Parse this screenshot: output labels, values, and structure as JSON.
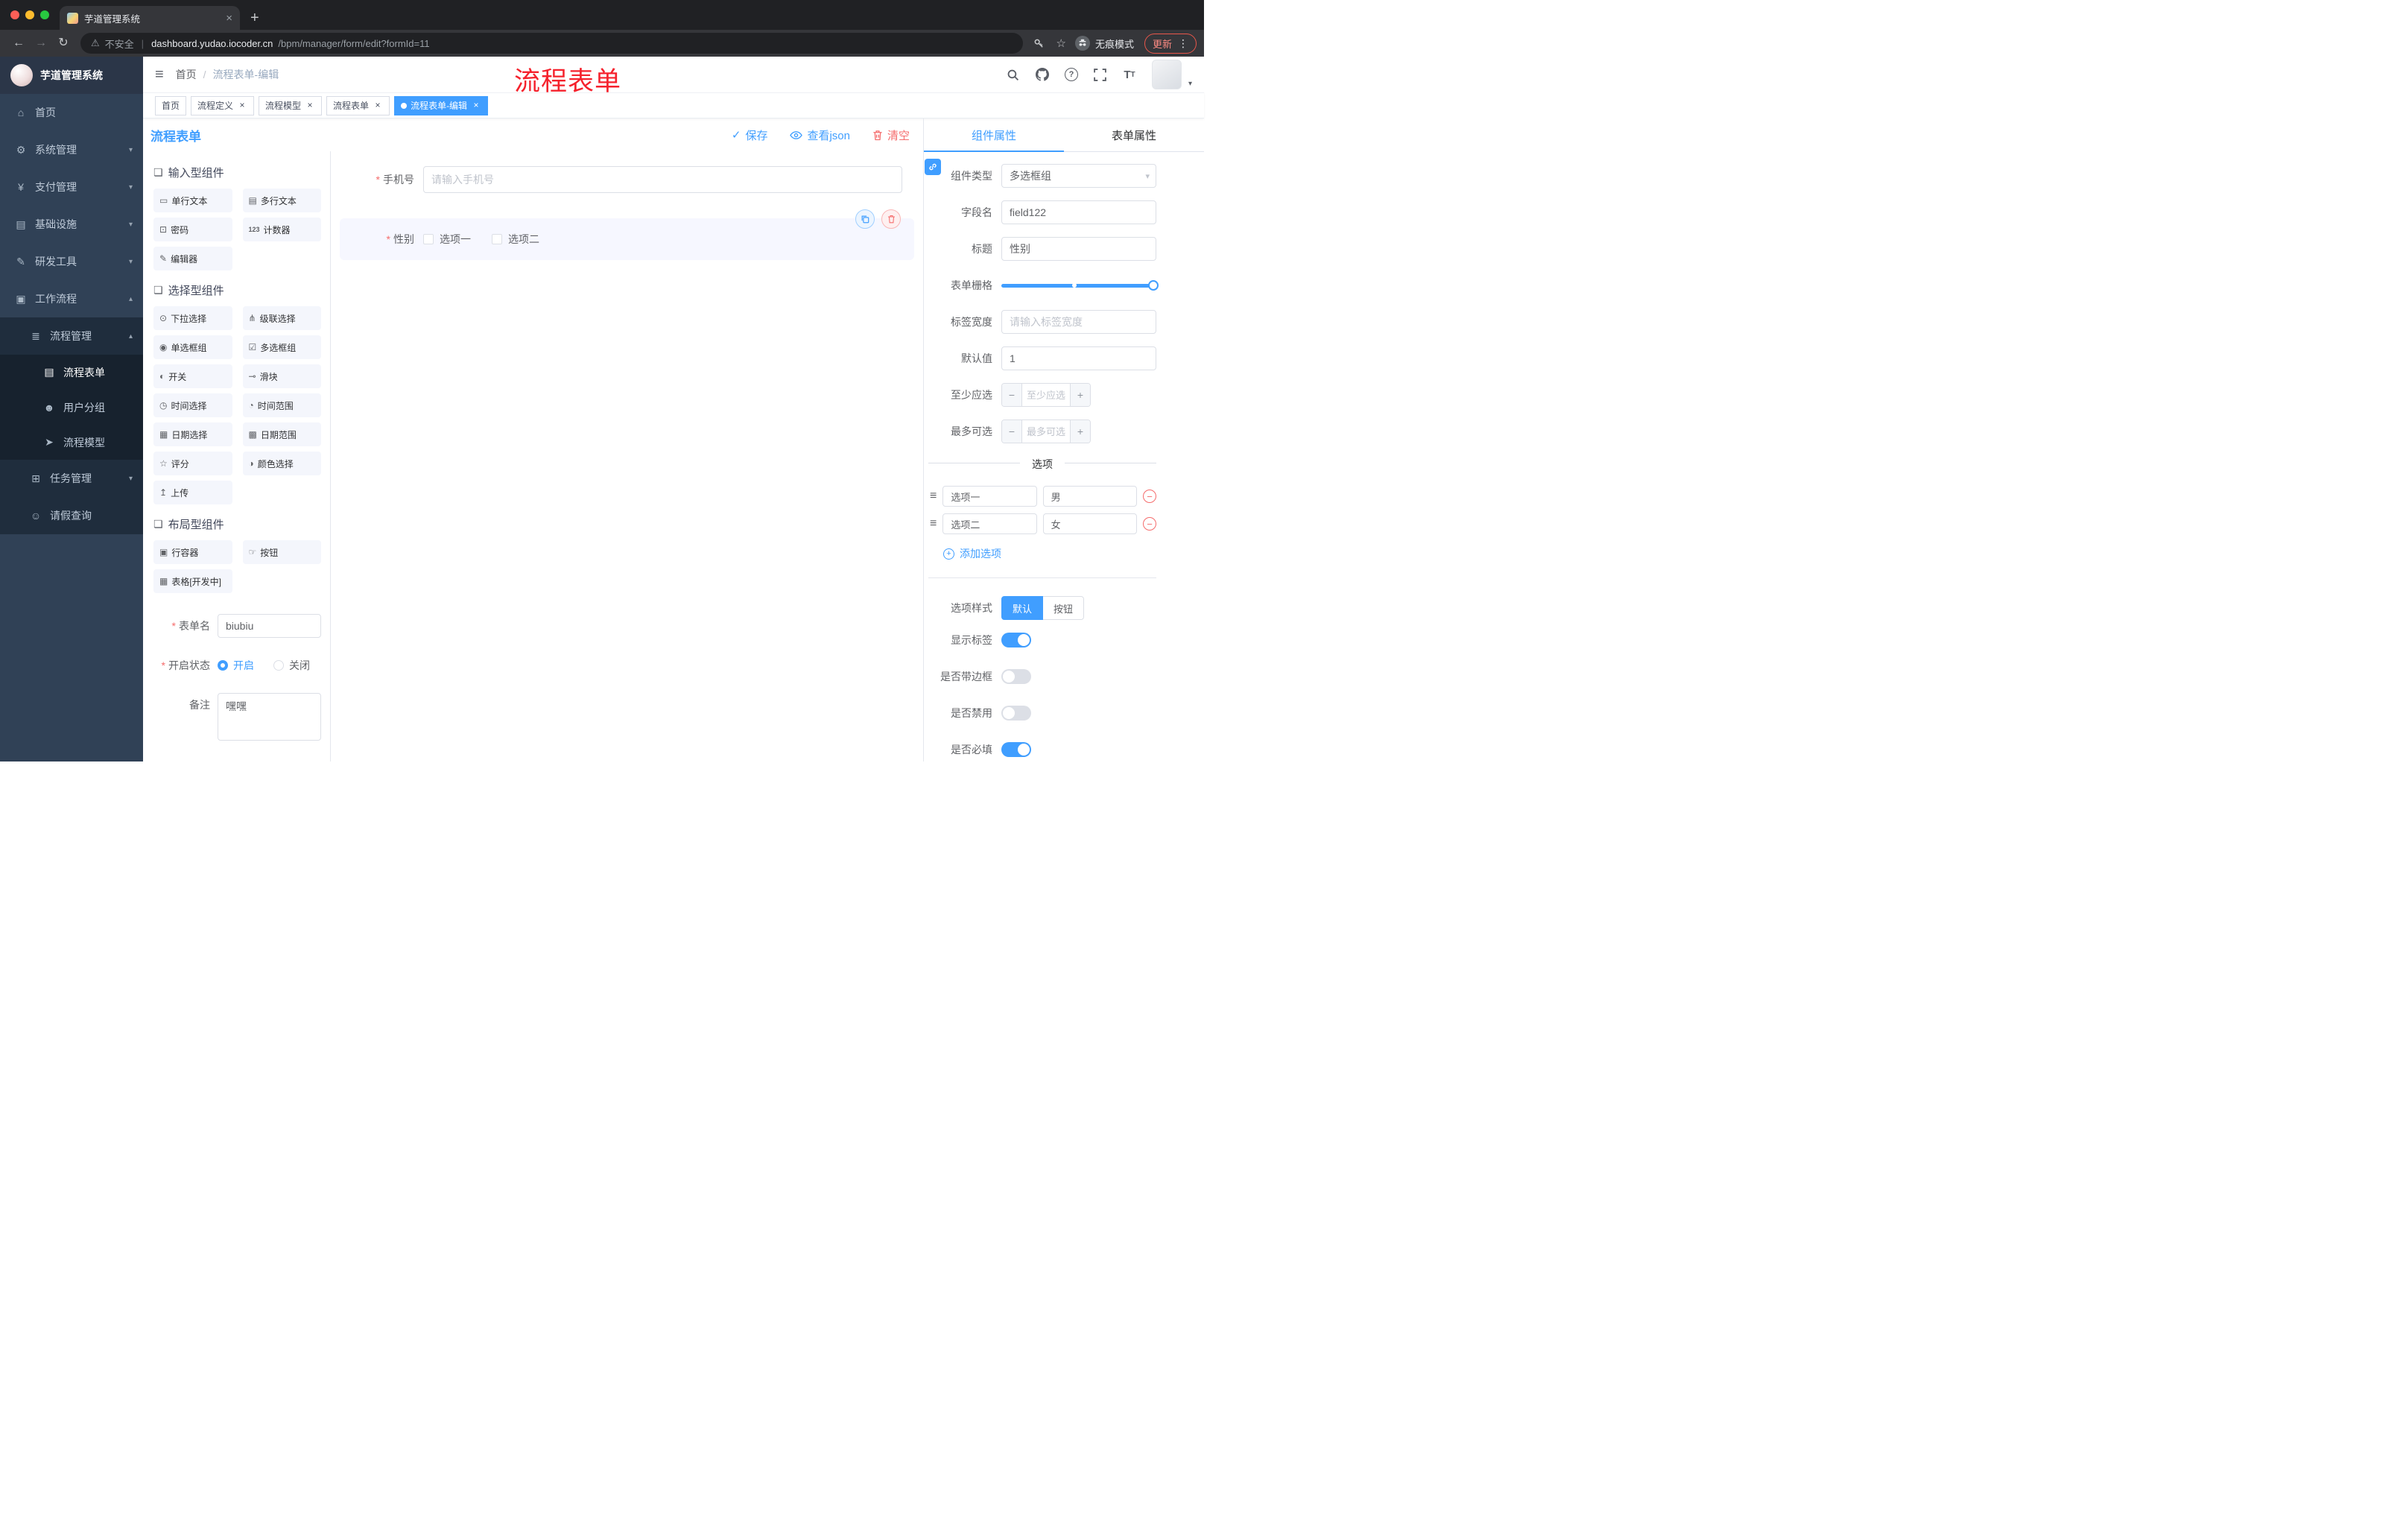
{
  "colors": {
    "primary": "#409eff",
    "danger": "#f56c6c",
    "annotation": "#f5222d",
    "sidebar": "#304156",
    "tag_active": "#409eff"
  },
  "chrome": {
    "tab_title": "芋道管理系统",
    "security": "不安全",
    "url_domain": "dashboard.yudao.iocoder.cn",
    "url_path": "/bpm/manager/form/edit?formId=11",
    "incognito": "无痕模式",
    "update": "更新"
  },
  "sidebar": {
    "logo": "芋道管理系统",
    "items": [
      {
        "label": "首页"
      },
      {
        "label": "系统管理"
      },
      {
        "label": "支付管理"
      },
      {
        "label": "基础设施"
      },
      {
        "label": "研发工具"
      },
      {
        "label": "工作流程"
      },
      {
        "label": "流程管理"
      },
      {
        "label": "流程表单"
      },
      {
        "label": "用户分组"
      },
      {
        "label": "流程模型"
      },
      {
        "label": "任务管理"
      },
      {
        "label": "请假查询"
      }
    ]
  },
  "header": {
    "breadcrumb": [
      "首页",
      "流程表单-编辑"
    ],
    "annotation": "流程表单"
  },
  "tags": [
    {
      "label": "首页",
      "closable": false,
      "active": false
    },
    {
      "label": "流程定义",
      "closable": true,
      "active": false
    },
    {
      "label": "流程模型",
      "closable": true,
      "active": false
    },
    {
      "label": "流程表单",
      "closable": true,
      "active": false
    },
    {
      "label": "流程表单-编辑",
      "closable": true,
      "active": true
    }
  ],
  "toolbar": {
    "title": "流程表单",
    "save": "保存",
    "view_json": "查看json",
    "clear": "清空"
  },
  "palette": {
    "sections": [
      {
        "title": "输入型组件",
        "items": [
          {
            "icon": "single-line-text-icon",
            "label": "单行文本"
          },
          {
            "icon": "multi-line-text-icon",
            "label": "多行文本"
          },
          {
            "icon": "password-icon",
            "label": "密码"
          },
          {
            "icon": "counter-icon",
            "label": "计数器"
          },
          {
            "icon": "editor-icon",
            "label": "编辑器"
          }
        ]
      },
      {
        "title": "选择型组件",
        "items": [
          {
            "icon": "dropdown-icon",
            "label": "下拉选择"
          },
          {
            "icon": "cascader-icon",
            "label": "级联选择"
          },
          {
            "icon": "radio-group-icon",
            "label": "单选框组"
          },
          {
            "icon": "checkbox-group-icon",
            "label": "多选框组"
          },
          {
            "icon": "switch-icon",
            "label": "开关"
          },
          {
            "icon": "slider-icon",
            "label": "滑块"
          },
          {
            "icon": "time-picker-icon",
            "label": "时间选择"
          },
          {
            "icon": "time-range-icon",
            "label": "时间范围"
          },
          {
            "icon": "date-picker-icon",
            "label": "日期选择"
          },
          {
            "icon": "date-range-icon",
            "label": "日期范围"
          },
          {
            "icon": "rate-icon",
            "label": "评分"
          },
          {
            "icon": "color-picker-icon",
            "label": "颜色选择"
          },
          {
            "icon": "upload-icon",
            "label": "上传"
          }
        ]
      },
      {
        "title": "布局型组件",
        "items": [
          {
            "icon": "row-container-icon",
            "label": "行容器"
          },
          {
            "icon": "button-icon",
            "label": "按钮"
          },
          {
            "icon": "table-icon",
            "label": "表格[开发中]"
          }
        ]
      }
    ]
  },
  "left_form": {
    "form_name_label": "表单名",
    "form_name_value": "biubiu",
    "status_label": "开启状态",
    "status_on": "开启",
    "status_off": "关闭",
    "remark_label": "备注",
    "remark_value": "嘿嘿"
  },
  "canvas": {
    "phone_label": "手机号",
    "phone_placeholder": "请输入手机号",
    "gender_label": "性别",
    "gender_options": [
      "选项一",
      "选项二"
    ]
  },
  "props": {
    "tab_component": "组件属性",
    "tab_form": "表单属性",
    "component_type_label": "组件类型",
    "component_type_value": "多选框组",
    "field_name_label": "字段名",
    "field_name_value": "field122",
    "title_label": "标题",
    "title_value": "性别",
    "grid_label": "表单栅格",
    "label_width_label": "标签宽度",
    "label_width_placeholder": "请输入标签宽度",
    "default_label": "默认值",
    "default_value": "1",
    "min_label": "至少应选",
    "min_placeholder": "至少应选",
    "max_label": "最多可选",
    "max_placeholder": "最多可选",
    "options_title": "选项",
    "options": [
      {
        "label": "选项一",
        "value": "男"
      },
      {
        "label": "选项二",
        "value": "女"
      }
    ],
    "add_option": "添加选项",
    "option_style_label": "选项样式",
    "style_default": "默认",
    "style_button": "按钮",
    "toggles": [
      {
        "label": "显示标签",
        "on": true
      },
      {
        "label": "是否带边框",
        "on": false
      },
      {
        "label": "是否禁用",
        "on": false
      },
      {
        "label": "是否必填",
        "on": true
      }
    ]
  }
}
